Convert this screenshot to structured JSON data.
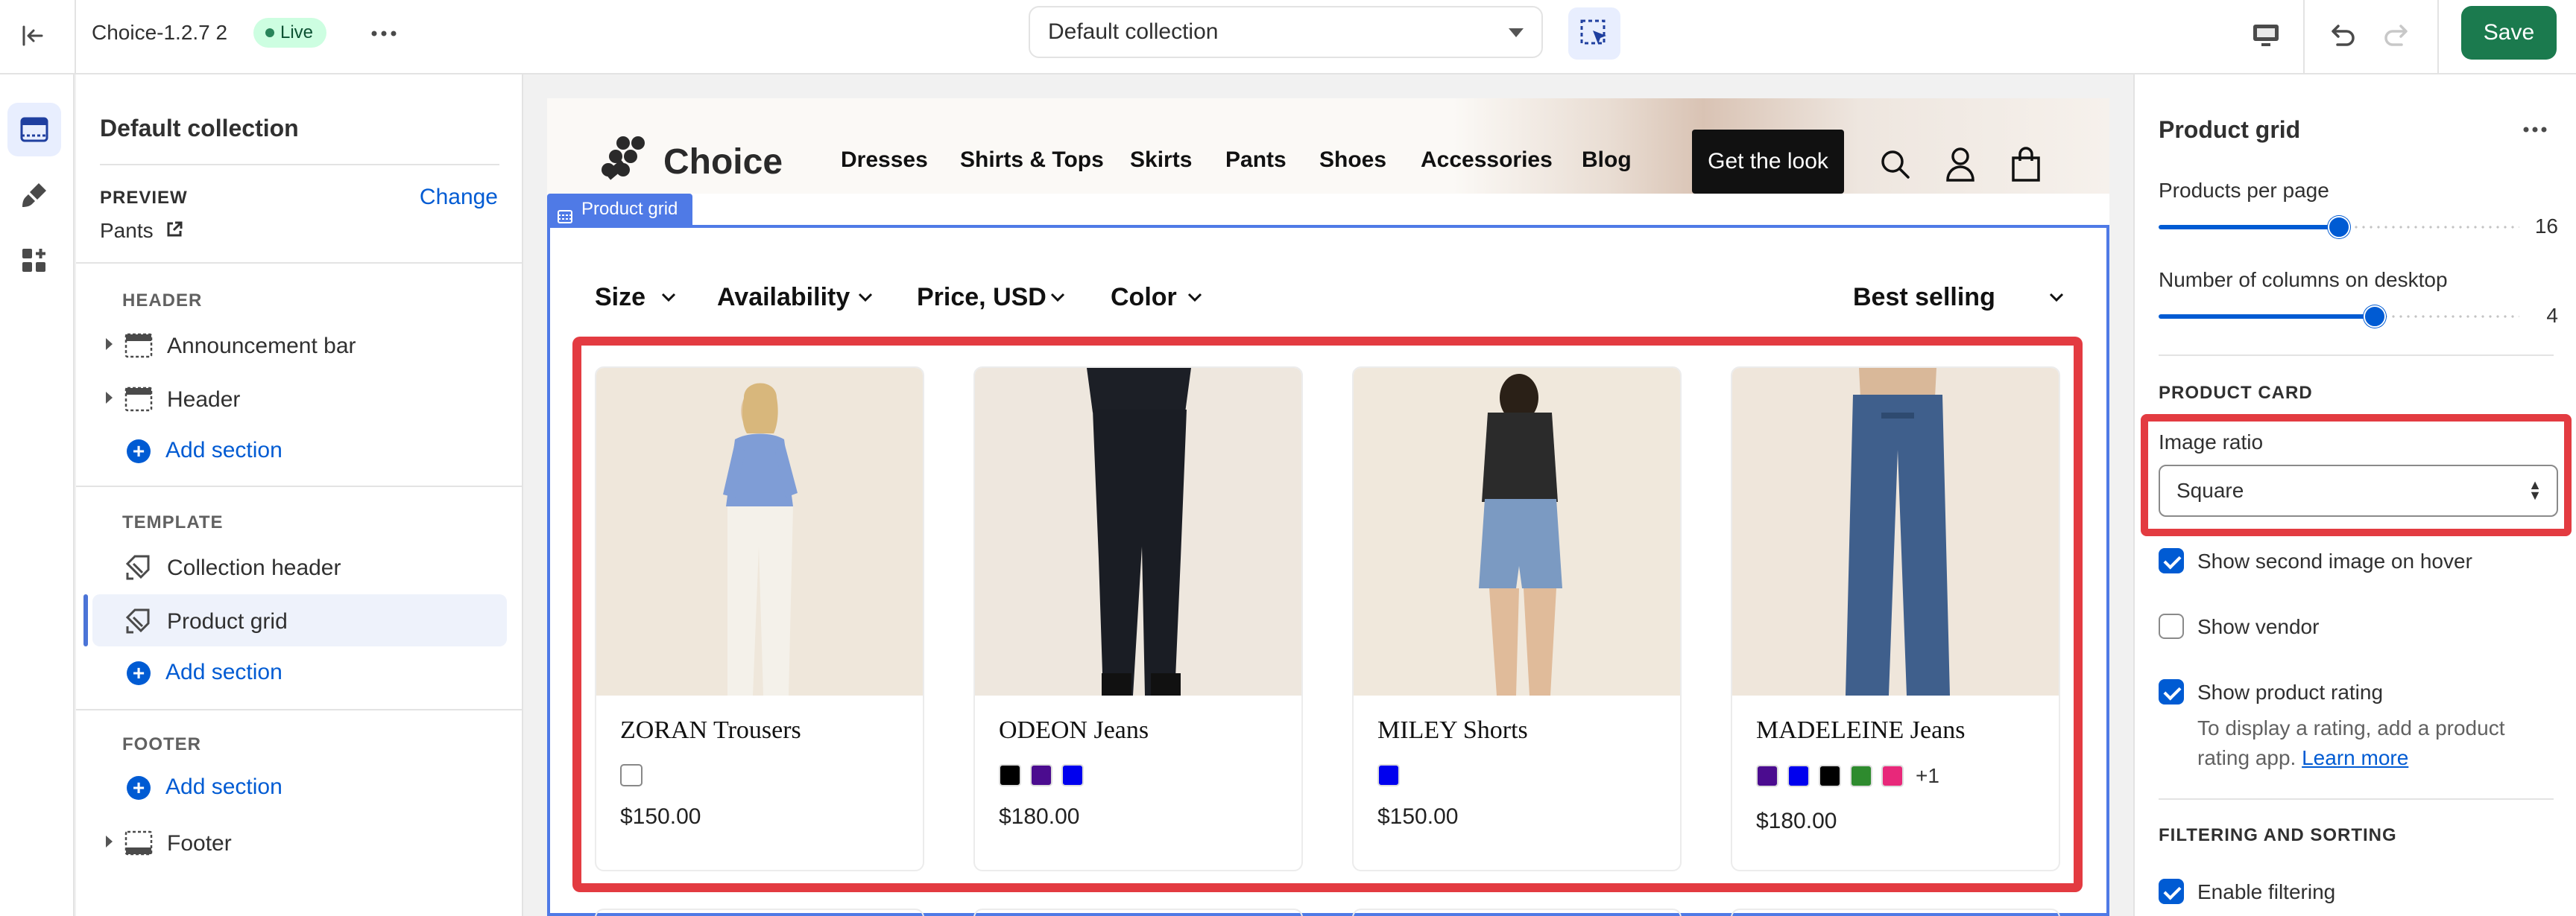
{
  "topbar": {
    "theme_name": "Choice-1.2.7 2",
    "live_badge": "Live",
    "collection_select": "Default collection",
    "save_label": "Save"
  },
  "left_panel": {
    "title": "Default collection",
    "preview_label": "PREVIEW",
    "change_link": "Change",
    "preview_value": "Pants",
    "header_group": "HEADER",
    "header_items": [
      "Announcement bar",
      "Header"
    ],
    "template_group": "TEMPLATE",
    "template_items": [
      "Collection header",
      "Product grid"
    ],
    "footer_group": "FOOTER",
    "footer_items": [
      "Footer"
    ],
    "add_section": "Add section"
  },
  "store": {
    "brand": "Choice",
    "nav": [
      "Dresses",
      "Shirts & Tops",
      "Skirts",
      "Pants",
      "Shoes",
      "Accessories",
      "Blog"
    ],
    "cta": "Get the look",
    "section_tag": "Product grid",
    "filters": [
      "Size",
      "Availability",
      "Price, USD",
      "Color"
    ],
    "sort": "Best selling",
    "products": [
      {
        "name": "ZORAN Trousers",
        "price": "$150.00",
        "swatches": [
          "#ffffff"
        ],
        "more": ""
      },
      {
        "name": "ODEON Jeans",
        "price": "$180.00",
        "swatches": [
          "#000000",
          "#4b0c8f",
          "#0000ee"
        ],
        "more": ""
      },
      {
        "name": "MILEY Shorts",
        "price": "$150.00",
        "swatches": [
          "#0000ee"
        ],
        "more": ""
      },
      {
        "name": "MADELEINE Jeans",
        "price": "$180.00",
        "swatches": [
          "#4b0c8f",
          "#0000ee",
          "#000000",
          "#2e8b2e",
          "#e8287a"
        ],
        "more": "+1"
      }
    ]
  },
  "right_panel": {
    "title": "Product grid",
    "products_per_page_label": "Products per page",
    "products_per_page_value": "16",
    "products_per_page_fraction": 0.5,
    "columns_label": "Number of columns on desktop",
    "columns_value": "4",
    "columns_fraction": 0.6,
    "product_card_group": "PRODUCT CARD",
    "image_ratio_label": "Image ratio",
    "image_ratio_value": "Square",
    "show_second_image": "Show second image on hover",
    "show_vendor": "Show vendor",
    "show_rating": "Show product rating",
    "rating_help": "To display a rating, add a product rating app.",
    "learn_more": "Learn more",
    "filtering_group": "FILTERING AND SORTING",
    "enable_filtering": "Enable filtering"
  },
  "colors": {
    "accent": "#005bd3",
    "save": "#1b7a4e",
    "highlight": "#e33b41",
    "section_outline": "#4f7ae6"
  }
}
